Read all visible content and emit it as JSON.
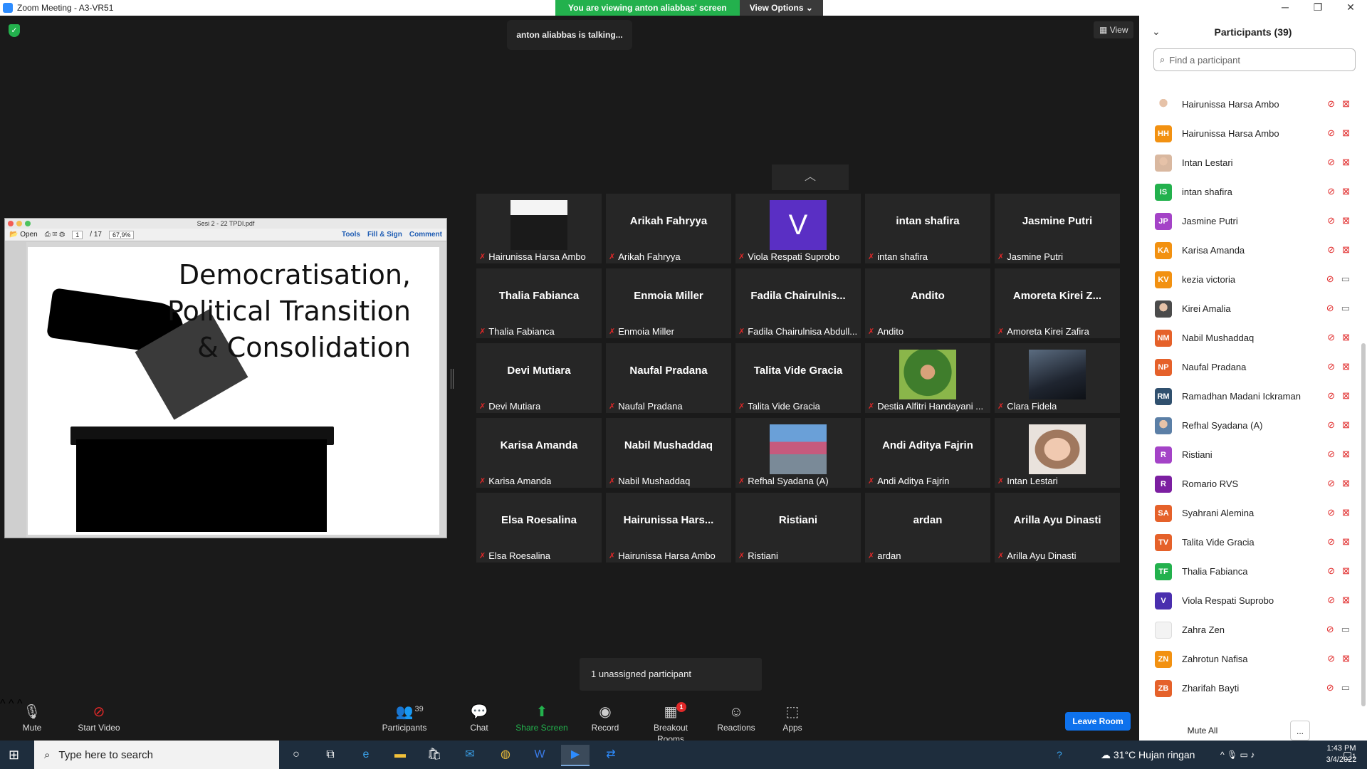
{
  "window": {
    "title": "Zoom Meeting - A3-VR51"
  },
  "share_banner": {
    "text": "You are viewing anton aliabbas' screen",
    "options_label": "View Options"
  },
  "talking_indicator": "anton aliabbas is talking...",
  "view_button": "View",
  "pdf": {
    "filename": "Sesi 2 - 22 TPDI.pdf",
    "open": "Open",
    "page": "1",
    "page_total": "/ 17",
    "zoom": "67,9%",
    "tools": "Tools",
    "fill_sign": "Fill & Sign",
    "comment": "Comment",
    "slide_lines": [
      "Democratisation,",
      "Political Transition",
      "& Consolidation"
    ]
  },
  "grid": {
    "tiles": [
      {
        "big": "",
        "name": "Hairunissa Harsa Ambo",
        "photo": "hijab"
      },
      {
        "big": "Arikah Fahryya",
        "name": "Arikah Fahryya"
      },
      {
        "big": "",
        "name": "Viola Respati Suprobo",
        "letter": "V"
      },
      {
        "big": "intan shafira",
        "name": "intan shafira"
      },
      {
        "big": "Jasmine Putri",
        "name": "Jasmine Putri"
      },
      {
        "big": "Thalia Fabianca",
        "name": "Thalia Fabianca"
      },
      {
        "big": "Enmoia Miller",
        "name": "Enmoia Miller"
      },
      {
        "big": "Fadila  Chairulnis...",
        "name": "Fadila Chairulnisa Abdull..."
      },
      {
        "big": "Andito",
        "name": "Andito"
      },
      {
        "big": "Amoreta  Kirei  Z...",
        "name": "Amoreta Kirei Zafira"
      },
      {
        "big": "Devi Mutiara",
        "name": "Devi Mutiara"
      },
      {
        "big": "Naufal Pradana",
        "name": "Naufal Pradana"
      },
      {
        "big": "Talita Vide Gracia",
        "name": "Talita Vide Gracia"
      },
      {
        "big": "",
        "name": "Destia Alfitri Handayani ...",
        "photo": "green"
      },
      {
        "big": "",
        "name": "Clara Fidela",
        "photo": "dark"
      },
      {
        "big": "Karisa Amanda",
        "name": "Karisa Amanda"
      },
      {
        "big": "Nabil Mushaddaq",
        "name": "Nabil Mushaddaq"
      },
      {
        "big": "",
        "name": "Refhal Syadana (A)",
        "photo": "street"
      },
      {
        "big": "Andi Aditya Fajrin",
        "name": "Andi Aditya Fajrin"
      },
      {
        "big": "",
        "name": "Intan Lestari",
        "photo": "face"
      },
      {
        "big": "Elsa Roesalina",
        "name": "Elsa Roesalina"
      },
      {
        "big": "Hairunissa  Hars...",
        "name": "Hairunissa Harsa Ambo"
      },
      {
        "big": "Ristiani",
        "name": "Ristiani"
      },
      {
        "big": "ardan",
        "name": "ardan"
      },
      {
        "big": "Arilla Ayu Dinasti",
        "name": "Arilla Ayu Dinasti"
      }
    ]
  },
  "unassigned": "1 unassigned participant",
  "panel": {
    "title": "Participants (39)",
    "search_placeholder": "Find a participant",
    "participants": [
      {
        "initials": "",
        "name": "Hairunissa Harsa Ambo",
        "color": "#ffffff",
        "photo": true,
        "cam": "off"
      },
      {
        "initials": "HH",
        "name": "Hairunissa Harsa Ambo",
        "color": "#f29111",
        "cam": "off"
      },
      {
        "initials": "",
        "name": "Intan Lestari",
        "color": "#d9b8a0",
        "photo": true,
        "cam": "off"
      },
      {
        "initials": "IS",
        "name": "intan shafira",
        "color": "#23b14d",
        "cam": "off"
      },
      {
        "initials": "JP",
        "name": "Jasmine Putri",
        "color": "#a443c7",
        "cam": "off"
      },
      {
        "initials": "KA",
        "name": "Karisa Amanda",
        "color": "#f29111",
        "cam": "off"
      },
      {
        "initials": "KV",
        "name": "kezia victoria",
        "color": "#f29111",
        "cam": "on"
      },
      {
        "initials": "",
        "name": "Kirei Amalia",
        "color": "#4b4b4b",
        "photo": true,
        "cam": "on"
      },
      {
        "initials": "NM",
        "name": "Nabil Mushaddaq",
        "color": "#e5612a",
        "cam": "off"
      },
      {
        "initials": "NP",
        "name": "Naufal Pradana",
        "color": "#e5612a",
        "cam": "off"
      },
      {
        "initials": "RM",
        "name": "Ramadhan Madani Ickraman",
        "color": "#30506e",
        "cam": "off"
      },
      {
        "initials": "",
        "name": "Refhal Syadana (A)",
        "color": "#5b7fa6",
        "photo": true,
        "cam": "off"
      },
      {
        "initials": "R",
        "name": "Ristiani",
        "color": "#a443c7",
        "cam": "off"
      },
      {
        "initials": "R",
        "name": "Romario RVS",
        "color": "#7c1fa1",
        "cam": "off"
      },
      {
        "initials": "SA",
        "name": "Syahrani Alemina",
        "color": "#e5612a",
        "cam": "off"
      },
      {
        "initials": "TV",
        "name": "Talita Vide Gracia",
        "color": "#e5612a",
        "cam": "off"
      },
      {
        "initials": "TF",
        "name": "Thalia Fabianca",
        "color": "#23b14d",
        "cam": "off"
      },
      {
        "initials": "V",
        "name": "Viola Respati Suprobo",
        "color": "#4a2fae",
        "cam": "off"
      },
      {
        "initials": "",
        "name": "Zahra Zen",
        "color": "#f3f3f3",
        "cam": "on"
      },
      {
        "initials": "ZN",
        "name": "Zahrotun Nafisa",
        "color": "#f29111",
        "cam": "off"
      },
      {
        "initials": "ZB",
        "name": "Zharifah Bayti",
        "color": "#e5612a",
        "cam": "on"
      }
    ],
    "mute_all": "Mute All",
    "more": "..."
  },
  "controls": {
    "mute": "Mute",
    "start_video": "Start Video",
    "participants": "Participants",
    "participants_count": "39",
    "chat": "Chat",
    "share_screen": "Share Screen",
    "record": "Record",
    "breakout": "Breakout Rooms",
    "breakout_badge": "1",
    "reactions": "Reactions",
    "apps": "Apps",
    "leave": "Leave Room"
  },
  "taskbar": {
    "search_placeholder": "Type here to search",
    "weather": "31°C  Hujan ringan",
    "time": "1:43 PM",
    "date": "3/4/2022",
    "notif_count": "1"
  }
}
